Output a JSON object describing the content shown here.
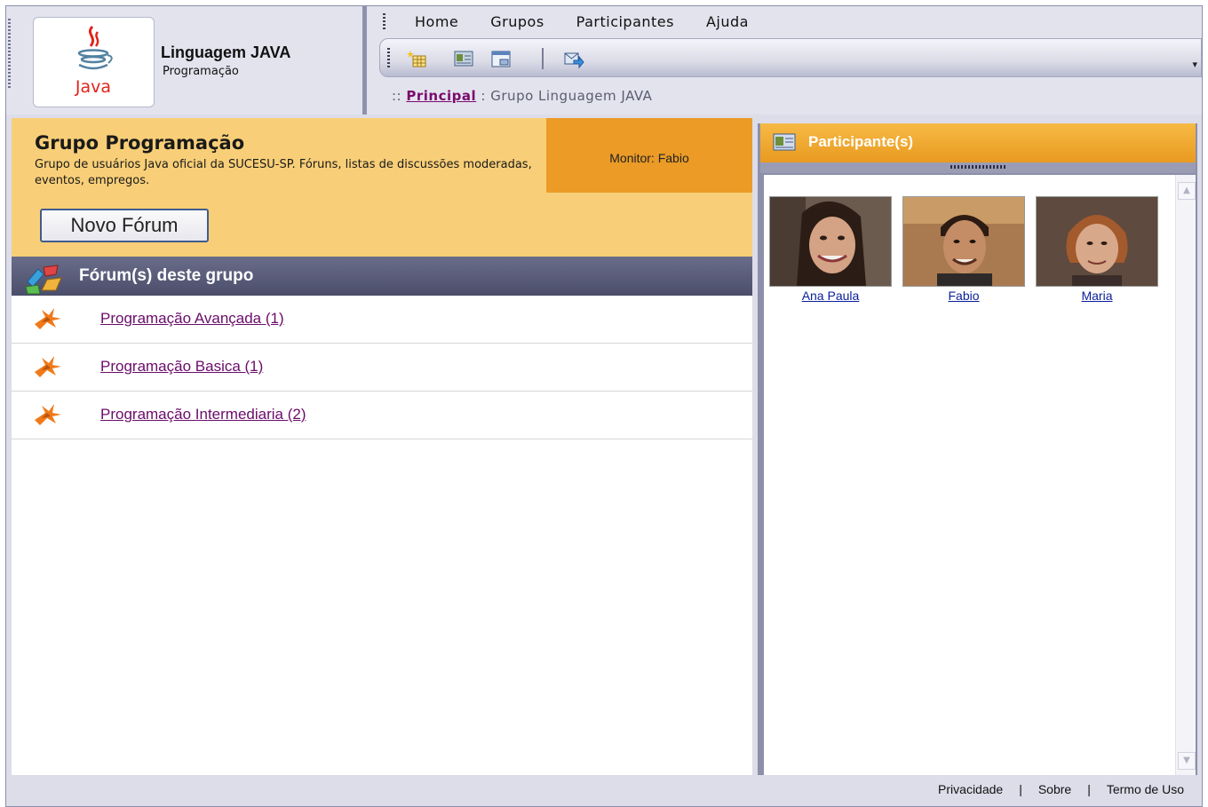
{
  "header": {
    "group_name": "Linguagem JAVA",
    "group_category": "Programação",
    "logo_text": "Java"
  },
  "menu": [
    "Home",
    "Grupos",
    "Participantes",
    "Ajuda"
  ],
  "toolbar": {
    "icons": [
      "new-item-icon",
      "properties-icon",
      "window-icon",
      "send-icon"
    ]
  },
  "breadcrumb": {
    "prefix": "::",
    "link": "Principal",
    "separator": ":",
    "current": "Grupo Linguagem JAVA"
  },
  "group": {
    "title": "Grupo Programação",
    "description": "Grupo de usuários Java oficial da SUCESU-SP. Fóruns, listas de discussões moderadas, eventos, empregos.",
    "monitor": "Monitor: Fabio",
    "new_forum_button": "Novo Fórum"
  },
  "forums": {
    "title": "Fórum(s) deste grupo",
    "items": [
      {
        "label": "Programação Avançada (1)"
      },
      {
        "label": "Programação Basica (1)"
      },
      {
        "label": "Programação Intermediaria (2)"
      }
    ]
  },
  "participants": {
    "title": "Participante(s)",
    "people": [
      {
        "name": "Ana Paula"
      },
      {
        "name": "Fabio"
      },
      {
        "name": "Maria"
      }
    ]
  },
  "footer": {
    "links": [
      "Privacidade",
      "Sobre",
      "Termo de Uso"
    ],
    "separator": "|"
  },
  "colors": {
    "banner": "#f8cf78",
    "monitor_box": "#eb9b26",
    "forum_bar": "#55587a",
    "participants_header": "#f0a932",
    "link": "#6a0c6a"
  }
}
